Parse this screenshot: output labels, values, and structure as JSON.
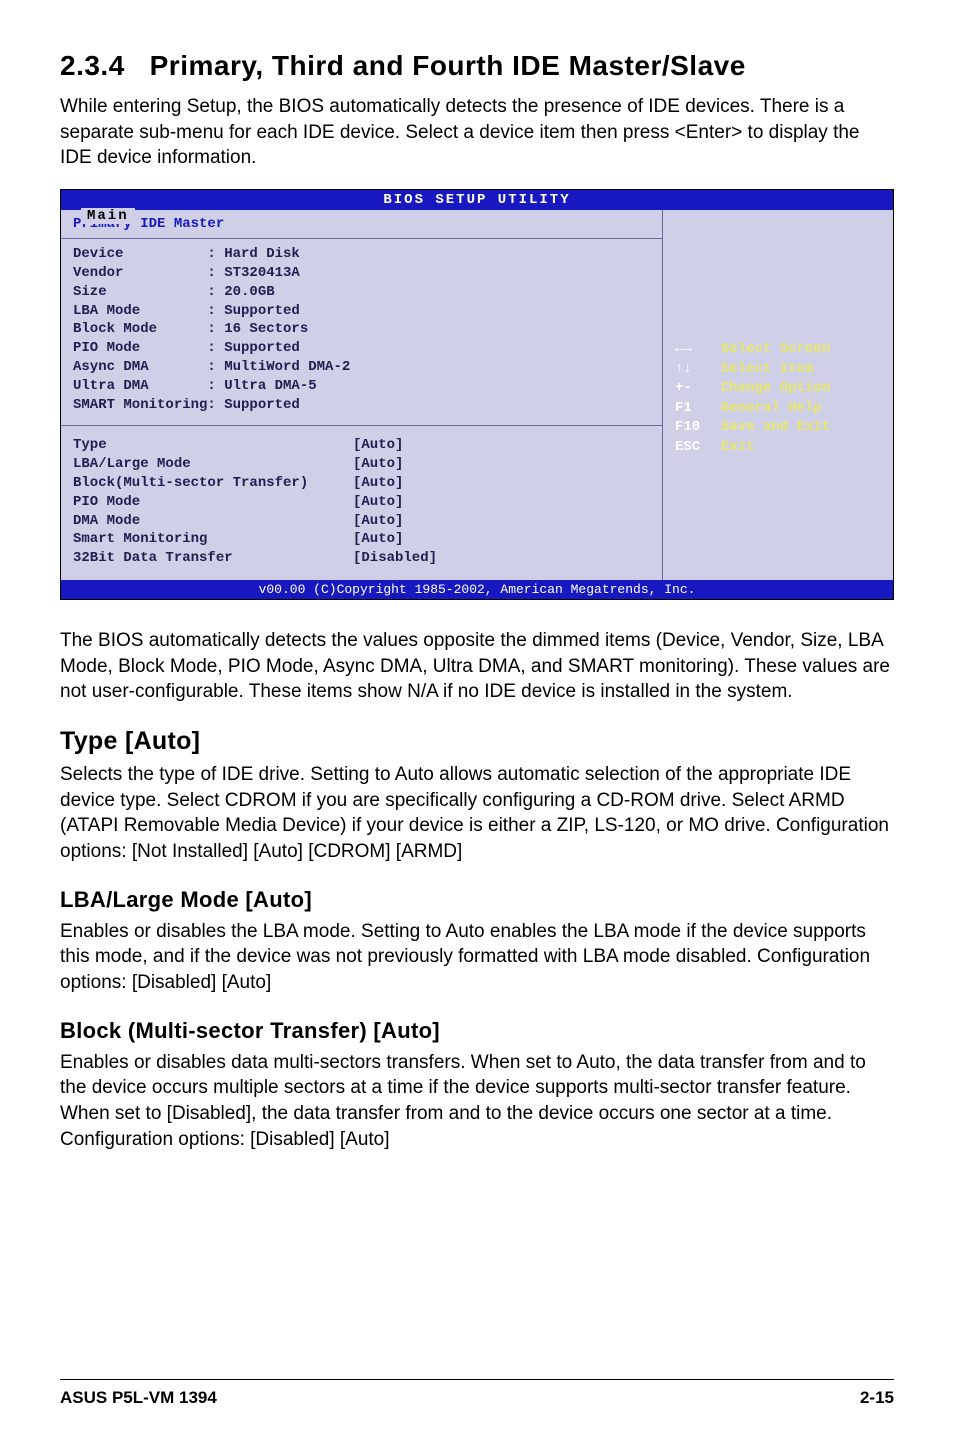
{
  "section": {
    "number": "2.3.4",
    "title": "Primary, Third and Fourth IDE Master/Slave",
    "intro": "While entering Setup, the BIOS automatically detects the presence of IDE devices. There is a separate sub-menu for each IDE device. Select a device item then press <Enter> to display the IDE device information."
  },
  "bios": {
    "window_title": "BIOS SETUP UTILITY",
    "tab": "Main",
    "panel_title": "Primary IDE Master",
    "specs": [
      {
        "k": "Device",
        "v": "Hard Disk"
      },
      {
        "k": "Vendor",
        "v": "ST320413A"
      },
      {
        "k": "Size",
        "v": "20.0GB"
      },
      {
        "k": "LBA Mode",
        "v": "Supported"
      },
      {
        "k": "Block Mode",
        "v": "16 Sectors"
      },
      {
        "k": "PIO Mode",
        "v": "Supported"
      },
      {
        "k": "Async DMA",
        "v": "MultiWord DMA-2"
      },
      {
        "k": "Ultra DMA",
        "v": "Ultra DMA-5"
      },
      {
        "k": "SMART Monitoring",
        "v": "Supported"
      }
    ],
    "settings": [
      {
        "label": "Type",
        "value": "[Auto]"
      },
      {
        "label": "LBA/Large Mode",
        "value": "[Auto]"
      },
      {
        "label": "Block(Multi-sector Transfer)",
        "value": "[Auto]"
      },
      {
        "label": "PIO Mode",
        "value": "[Auto]"
      },
      {
        "label": "DMA Mode",
        "value": "[Auto]"
      },
      {
        "label": "Smart Monitoring",
        "value": "[Auto]"
      },
      {
        "label": "32Bit Data Transfer",
        "value": "[Disabled]"
      }
    ],
    "help": [
      {
        "key": "←→",
        "desc": "Select Screen"
      },
      {
        "key": "↑↓",
        "desc": "Select Item"
      },
      {
        "key": "+-",
        "desc": "Change Option"
      },
      {
        "key": "F1",
        "desc": "General Help"
      },
      {
        "key": "F10",
        "desc": "Save and Exit"
      },
      {
        "key": "ESC",
        "desc": "Exit"
      }
    ],
    "footer": "v00.00 (C)Copyright 1985-2002, American Megatrends, Inc."
  },
  "after_bios": "The BIOS automatically detects the values opposite the dimmed items (Device, Vendor, Size, LBA Mode, Block Mode, PIO Mode, Async DMA, Ultra DMA, and SMART monitoring). These values are not user-configurable. These items show N/A if no IDE device is installed in the system.",
  "type_section": {
    "title": "Type [Auto]",
    "body": "Selects the type of IDE drive. Setting to Auto allows automatic selection of the appropriate IDE device type. Select CDROM if you are specifically configuring a CD-ROM drive. Select ARMD (ATAPI Removable Media Device) if your device is either a ZIP, LS-120, or MO drive. Configuration options: [Not Installed] [Auto] [CDROM] [ARMD]"
  },
  "lba_section": {
    "title": "LBA/Large Mode [Auto]",
    "body": "Enables or disables the LBA mode. Setting to Auto enables the LBA mode if the device supports this mode, and if the device was not previously formatted with LBA mode disabled. Configuration options: [Disabled] [Auto]"
  },
  "block_section": {
    "title": "Block (Multi-sector Transfer) [Auto]",
    "body": "Enables or disables data multi-sectors transfers. When set to Auto, the data transfer from and to the device occurs multiple sectors at a time if the device supports multi-sector transfer feature. When set to [Disabled], the data transfer from and to the device occurs one sector at a time. Configuration options: [Disabled] [Auto]"
  },
  "footer": {
    "left": "ASUS P5L-VM 1394",
    "right": "2-15"
  }
}
